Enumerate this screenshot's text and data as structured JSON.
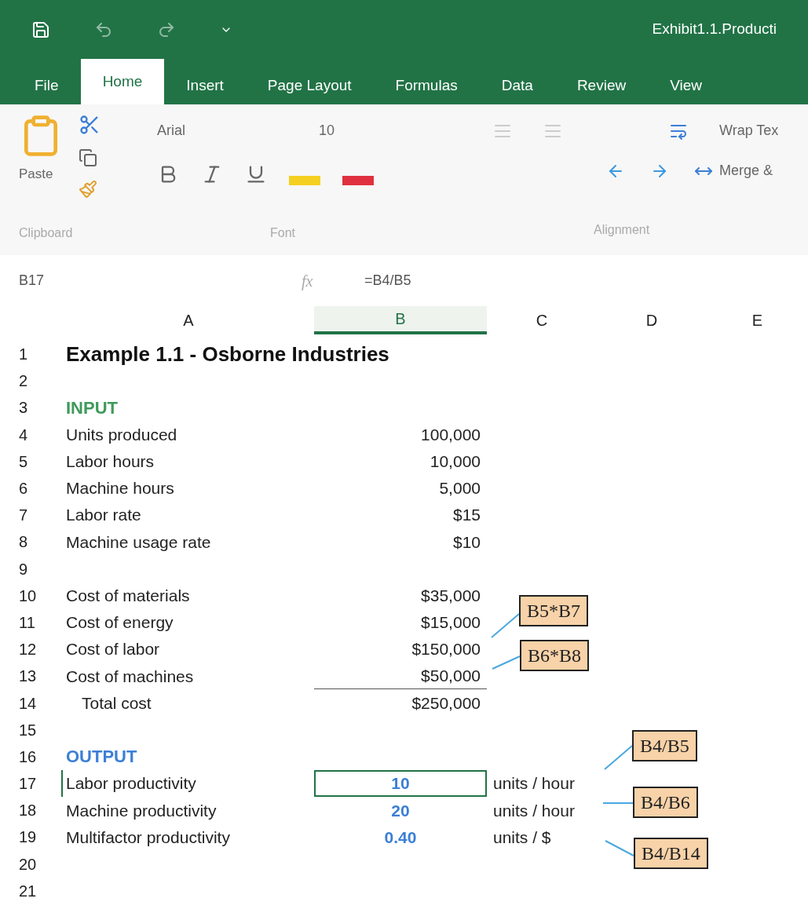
{
  "window": {
    "title": "Exhibit1.1.Producti"
  },
  "tabs": [
    {
      "label": "File",
      "selected": false
    },
    {
      "label": "Home",
      "selected": true
    },
    {
      "label": "Insert",
      "selected": false
    },
    {
      "label": "Page Layout",
      "selected": false
    },
    {
      "label": "Formulas",
      "selected": false
    },
    {
      "label": "Data",
      "selected": false
    },
    {
      "label": "Review",
      "selected": false
    },
    {
      "label": "View",
      "selected": false
    }
  ],
  "ribbon": {
    "paste_label": "Paste",
    "font_name": "Arial",
    "font_size": "10",
    "wrap_text": "Wrap Tex",
    "merge": "Merge &",
    "groups": [
      "Clipboard",
      "Font",
      "Alignment"
    ]
  },
  "formula_bar": {
    "name_box": "B17",
    "fx_label": "fx",
    "formula": "=B4/B5"
  },
  "columns": [
    {
      "label": "A",
      "selected": false
    },
    {
      "label": "B",
      "selected": true
    },
    {
      "label": "C",
      "selected": false
    },
    {
      "label": "D",
      "selected": false
    },
    {
      "label": "E",
      "selected": false
    }
  ],
  "rows": [
    {
      "number": "1",
      "kind": "title",
      "a": "Example 1.1 - Osborne Industries",
      "selected": false
    },
    {
      "number": "2",
      "kind": "normal",
      "selected": false
    },
    {
      "number": "3",
      "kind": "input-heading",
      "a": "INPUT",
      "selected": false
    },
    {
      "number": "4",
      "kind": "normal",
      "a": "Units produced",
      "b": "100,000",
      "selected": false
    },
    {
      "number": "5",
      "kind": "normal",
      "a": "Labor hours",
      "b": "10,000",
      "selected": false
    },
    {
      "number": "6",
      "kind": "normal",
      "a": "Machine hours",
      "b": "5,000",
      "selected": false
    },
    {
      "number": "7",
      "kind": "normal",
      "a": "Labor rate",
      "b": "$15",
      "selected": false
    },
    {
      "number": "8",
      "kind": "normal",
      "a": "Machine usage rate",
      "b": "$10",
      "selected": false
    },
    {
      "number": "9",
      "kind": "normal",
      "selected": false
    },
    {
      "number": "10",
      "kind": "normal",
      "a": "Cost of materials",
      "b": "$35,000",
      "selected": false
    },
    {
      "number": "11",
      "kind": "normal",
      "a": "Cost of energy",
      "b": "$15,000",
      "selected": false
    },
    {
      "number": "12",
      "kind": "normal",
      "a": "Cost of labor",
      "b": "$150,000",
      "selected": false
    },
    {
      "number": "13",
      "kind": "sum-line",
      "a": "Cost of machines",
      "b": "$50,000",
      "selected": false
    },
    {
      "number": "14",
      "kind": "total",
      "a": "Total cost",
      "b": "$250,000",
      "selected": false
    },
    {
      "number": "15",
      "kind": "normal",
      "selected": false
    },
    {
      "number": "16",
      "kind": "output-heading",
      "a": "OUTPUT",
      "selected": false
    },
    {
      "number": "17",
      "kind": "output",
      "a": "Labor productivity",
      "b": "10",
      "c": "units / hour",
      "selected": true
    },
    {
      "number": "18",
      "kind": "output",
      "a": "Machine productivity",
      "b": "20",
      "c": "units / hour",
      "selected": false
    },
    {
      "number": "19",
      "kind": "output",
      "a": "Multifactor productivity",
      "b": "0.40",
      "c": "units / $",
      "selected": false
    },
    {
      "number": "20",
      "kind": "normal",
      "selected": false
    },
    {
      "number": "21",
      "kind": "normal",
      "selected": false
    }
  ],
  "callouts": [
    {
      "text": "B5*B7"
    },
    {
      "text": "B6*B8"
    },
    {
      "text": "B4/B5"
    },
    {
      "text": "B4/B6"
    },
    {
      "text": "B4/B14"
    }
  ]
}
